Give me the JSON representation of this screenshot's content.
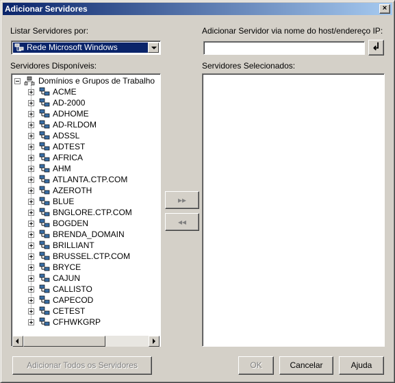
{
  "window": {
    "title": "Adicionar Servidores",
    "close_label": "×"
  },
  "list_by": {
    "label": "Listar Servidores por:",
    "selected": "Rede Microsoft Windows"
  },
  "add_by_host": {
    "label": "Adicionar Servidor via nome do host/endereço IP:",
    "value": "",
    "enter_label": "↲"
  },
  "available": {
    "label": "Servidores Disponíveis:",
    "root": "Domínios e Grupos de Trabalho",
    "items": [
      "ACME",
      "AD-2000",
      "ADHOME",
      "AD-RLDOM",
      "ADSSL",
      "ADTEST",
      "AFRICA",
      "AHM",
      "ATLANTA.CTP.COM",
      "AZEROTH",
      "BLUE",
      "BNGLORE.CTP.COM",
      "BOGDEN",
      "BRENDA_DOMAIN",
      "BRILLIANT",
      "BRUSSEL.CTP.COM",
      "BRYCE",
      "CAJUN",
      "CALLISTO",
      "CAPECOD",
      "CETEST",
      "CFHWKGRP"
    ]
  },
  "selected": {
    "label": "Servidores Selecionados:"
  },
  "transfer": {
    "add_label": "▸▸",
    "remove_label": "◂◂"
  },
  "buttons": {
    "add_all": "Adicionar Todos os Servidores",
    "ok": "OK",
    "cancel": "Cancelar",
    "help": "Ajuda"
  },
  "colors": {
    "titlebar_start": "#0a246a",
    "titlebar_end": "#a6caf0",
    "face": "#d4d0c8"
  }
}
